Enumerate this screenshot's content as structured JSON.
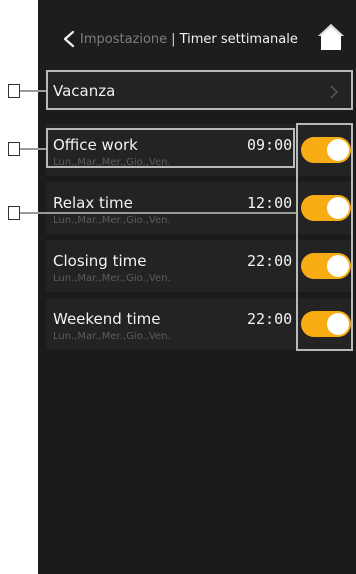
{
  "header": {
    "parent_label": "Impostazione",
    "separator": "|",
    "title": "Timer settimanale"
  },
  "vacation": {
    "label": "Vacanza"
  },
  "timers": [
    {
      "name": "Office work",
      "days": "Lun.,Mar.,Mer.,Gio.,Ven.",
      "time": "09:00",
      "enabled": true
    },
    {
      "name": "Relax time",
      "days": "Lun.,Mar.,Mer.,Gio.,Ven.",
      "time": "12:00",
      "enabled": true
    },
    {
      "name": "Closing time",
      "days": "Lun.,Mar.,Mer.,Gio.,Ven.",
      "time": "22:00",
      "enabled": true
    },
    {
      "name": "Weekend time",
      "days": "Lun.,Mar.,Mer.,Gio.,Ven.",
      "time": "22:00",
      "enabled": true
    }
  ],
  "colors": {
    "toggle_on": "#f7ac13",
    "background": "#1b1b1b"
  }
}
